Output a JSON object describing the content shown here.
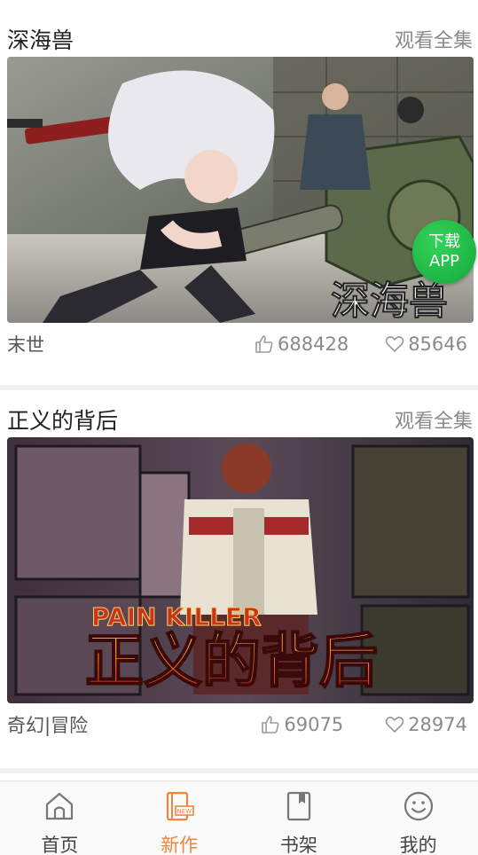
{
  "cards": [
    {
      "title": "深海兽",
      "more_label": "观看全集",
      "genre": "末世",
      "likes": "688428",
      "favorites": "85646",
      "cover_caption": "深海兽",
      "badge": {
        "line1": "下载",
        "line2": "APP"
      }
    },
    {
      "title": "正义的背后",
      "more_label": "观看全集",
      "genre": "奇幻|冒险",
      "likes": "69075",
      "favorites": "28974",
      "cover_caption_en": "PAIN KILLER",
      "cover_caption": "正义的背后"
    }
  ],
  "tabs": [
    {
      "label": "首页",
      "icon": "home-icon"
    },
    {
      "label": "新作",
      "icon": "new-book-icon"
    },
    {
      "label": "书架",
      "icon": "bookshelf-icon"
    },
    {
      "label": "我的",
      "icon": "smiley-profile-icon"
    }
  ],
  "colors": {
    "accent": "#f4843b",
    "badge": "#1fbf47"
  }
}
